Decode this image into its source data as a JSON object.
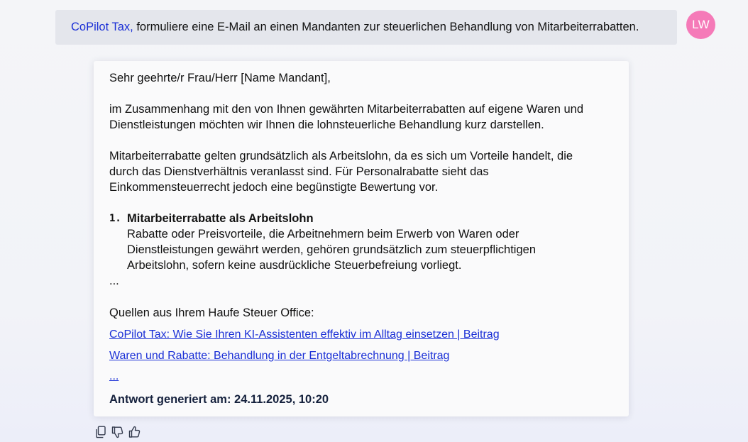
{
  "prompt": {
    "addressee": "CoPilot Tax,",
    "text": " formuliere eine E-Mail an einen Mandanten zur steuerlichen Behandlung von Mitarbeiterrabatten."
  },
  "user": {
    "initials": "LW",
    "avatar_color": "#f57ab8"
  },
  "response": {
    "greeting": "Sehr geehrte/r Frau/Herr [Name Mandant],",
    "para1": [
      "im Zusammenhang mit den von Ihnen gewährten Mitarbeiterrabatten auf eigene Waren und",
      "Dienstleistungen möchten wir Ihnen die lohnsteuerliche  Behandlung kurz darstellen."
    ],
    "para2": [
      "Mitarbeiterrabatte gelten grundsätzlich als Arbeitslohn, da es sich  um Vorteile handelt, die",
      "durch das Dienstverhältnis veranlasst sind. Für Personalrabatte sieht das",
      "Einkommensteuerrecht jedoch eine begünstigte  Bewertung vor."
    ],
    "list": [
      {
        "number": "1.",
        "title": "Mitarbeiterrabatte als Arbeitslohn",
        "lines": [
          "Rabatte oder Preisvorteile, die Arbeitnehmern beim Erwerb von Waren oder",
          "Dienstleistungen gewährt werden, gehören grundsätzlich zum  steuerpflichtigen",
          "Arbeitslohn, sofern keine ausdrückliche  Steuerbefreiung vorliegt."
        ]
      }
    ],
    "ellipsis": "...",
    "sources_heading": "Quellen aus Ihrem Haufe Steuer Office:",
    "sources": [
      "CoPilot Tax: Wie Sie Ihren KI-Assistenten effektiv im Alltag einsetzen | Beitrag",
      "Waren und Rabatte: Behandlung in der Entgeltabrechnung | Beitrag"
    ],
    "sources_more": "...",
    "generated_at": "Antwort generiert am: 24.11.2025, 10:20"
  },
  "actions": [
    {
      "icon": "copy-icon"
    },
    {
      "icon": "thumbs-down-icon"
    },
    {
      "icon": "thumbs-up-icon"
    }
  ],
  "colors": {
    "accent": "#1a2fd6",
    "prompt_bg": "#e4e6ec",
    "card_bg": "#fafafb"
  }
}
